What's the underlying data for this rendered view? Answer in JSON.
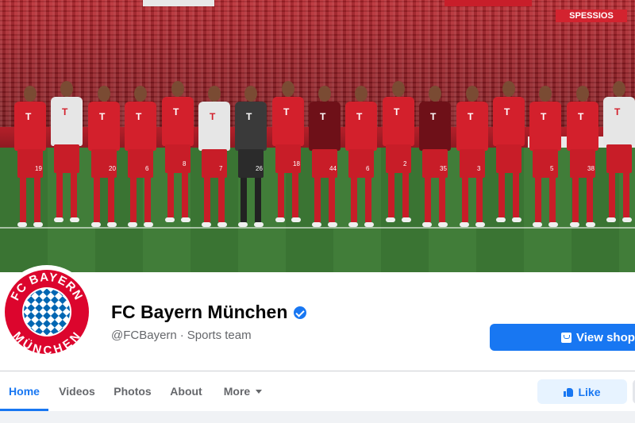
{
  "cover": {
    "stadium_banner": "SPESSIOS",
    "players": [
      {
        "kit": "red",
        "number": "19"
      },
      {
        "kit": "white",
        "number": ""
      },
      {
        "kit": "red",
        "number": "20"
      },
      {
        "kit": "red",
        "number": "6"
      },
      {
        "kit": "red",
        "number": "8"
      },
      {
        "kit": "white",
        "number": "7"
      },
      {
        "kit": "dark",
        "number": "26"
      },
      {
        "kit": "red",
        "number": "18"
      },
      {
        "kit": "darkred",
        "number": "44"
      },
      {
        "kit": "red",
        "number": "6"
      },
      {
        "kit": "red",
        "number": "2"
      },
      {
        "kit": "darkred",
        "number": "35"
      },
      {
        "kit": "red",
        "number": "3"
      },
      {
        "kit": "red",
        "number": ""
      },
      {
        "kit": "red",
        "number": "5"
      },
      {
        "kit": "red",
        "number": "38"
      },
      {
        "kit": "white",
        "number": ""
      }
    ]
  },
  "logo": {
    "top_text": "FC BAYERN",
    "bottom_text": "MÜNCHEN",
    "colors": {
      "red": "#dc052d",
      "blue": "#0066b2",
      "white": "#ffffff"
    }
  },
  "profile": {
    "name": "FC Bayern München",
    "handle": "@FCBayern",
    "separator": "·",
    "category": "Sports team",
    "verified_icon": "verified-badge-icon"
  },
  "actions": {
    "view_shop": "View shop",
    "like": "Like"
  },
  "tabs": [
    {
      "label": "Home",
      "active": true
    },
    {
      "label": "Videos",
      "active": false
    },
    {
      "label": "Photos",
      "active": false
    },
    {
      "label": "About",
      "active": false
    },
    {
      "label": "More",
      "active": false
    }
  ],
  "colors": {
    "accent": "#1877f2",
    "text_primary": "#050505",
    "text_secondary": "#65676b",
    "like_bg": "#e7f3ff"
  }
}
